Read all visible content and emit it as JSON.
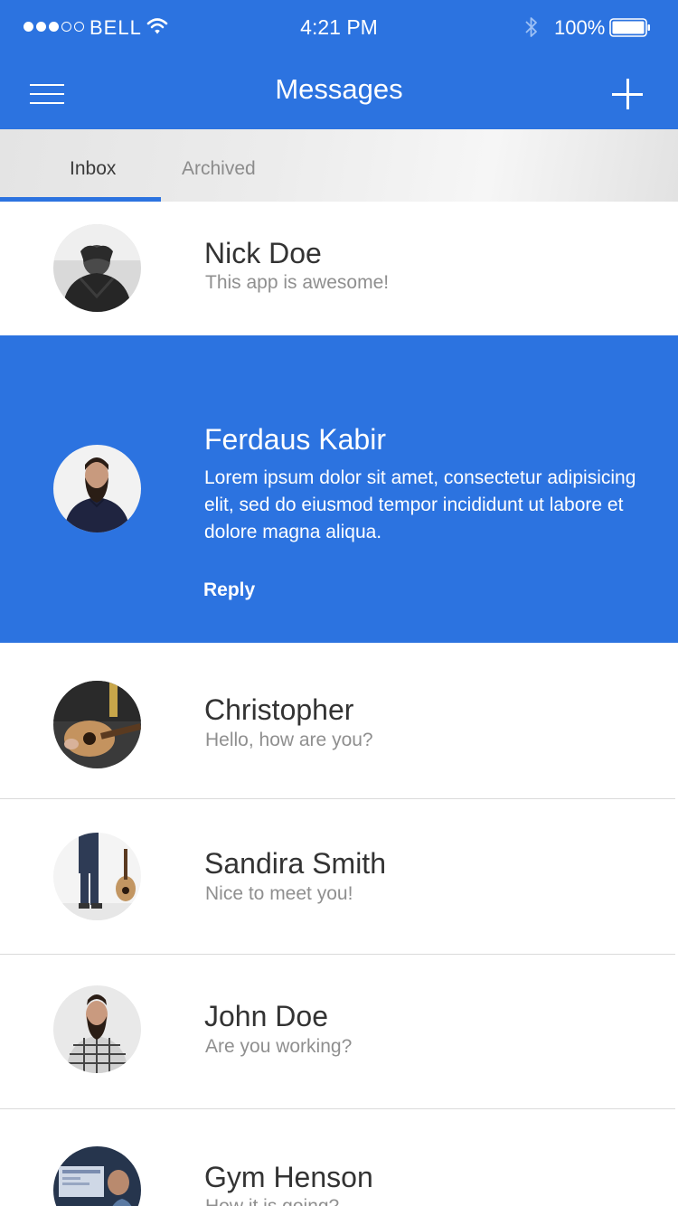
{
  "status_bar": {
    "signal_dots": [
      true,
      true,
      true,
      false,
      false
    ],
    "carrier": "BELL",
    "time": "4:21 PM",
    "battery_percent": "100%",
    "battery_level": 1.0
  },
  "nav": {
    "title": "Messages",
    "menu_icon": "hamburger-menu-icon",
    "add_icon": "plus-icon"
  },
  "tabs": [
    {
      "label": "Inbox",
      "active": true
    },
    {
      "label": "Archived",
      "active": false
    }
  ],
  "messages": [
    {
      "name": "Nick Doe",
      "preview": "This app is awesome!"
    },
    {
      "name": "Ferdaus Kabir",
      "body": "Lorem ipsum dolor sit amet, consectetur adipisicing elit, sed do eiusmod tempor incididunt ut labore et dolore magna aliqua.",
      "reply_label": "Reply",
      "expanded": true
    },
    {
      "name": "Christopher",
      "preview": "Hello, how are you?"
    },
    {
      "name": "Sandira Smith",
      "preview": "Nice to meet you!"
    },
    {
      "name": "John Doe",
      "preview": "Are you  working?"
    },
    {
      "name": "Gym Henson",
      "preview": "How it is going?"
    }
  ],
  "colors": {
    "accent": "#2c73e0",
    "text_primary": "#333333",
    "text_secondary": "#8f8f8f"
  }
}
